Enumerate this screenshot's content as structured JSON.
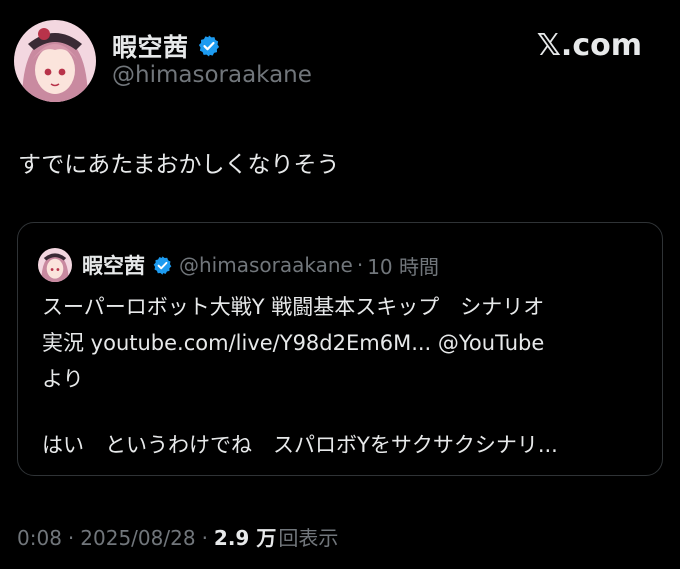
{
  "author": {
    "display_name": "暇空茜",
    "handle": "@himasoraakane",
    "avatar_icon": "anime-girl-avatar",
    "verified_icon": "verified-badge-icon"
  },
  "brand": {
    "logo_text": "𝕏.com"
  },
  "tweet": {
    "text": "すでにあたまおかしくなりそう"
  },
  "quote": {
    "display_name": "暇空茜",
    "handle": "@himasoraakane",
    "dot": "·",
    "time": "10 時間",
    "lines": [
      "スーパーロボット大戦Y 戦闘基本スキップ　シナリオ",
      "実況 youtube.com/live/Y98d2Em6M... @YouTube",
      "より",
      "はい　というわけでね　スパロボYをサクサクシナリ..."
    ]
  },
  "meta": {
    "time": "0:08",
    "sep": "·",
    "date": "2025/08/28",
    "views_count": "2.9 万",
    "views_label": "回表示"
  },
  "colors": {
    "background": "#000000",
    "text": "#e7e9ea",
    "muted": "#71767b",
    "verified": "#1d9bf0",
    "border": "#2f3336"
  }
}
